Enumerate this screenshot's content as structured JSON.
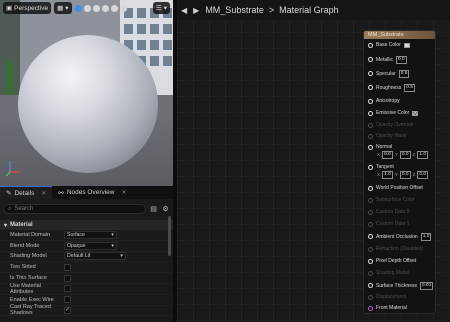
{
  "viewport": {
    "mode_label": "Perspective",
    "toolbar_icons": [
      "camera-icon",
      "view-mode-icon",
      "globe-icon",
      "sphere-preview-icon",
      "cylinder-preview-icon",
      "plane-preview-icon",
      "cube-preview-icon",
      "teapot-icon",
      "menu-icon"
    ]
  },
  "details": {
    "tabs": [
      {
        "label": "Details",
        "icon": "pencil-icon"
      },
      {
        "label": "Nodes Overview",
        "icon": "hierarchy-icon"
      }
    ],
    "search_placeholder": "Search",
    "section_title": "Material",
    "properties": [
      {
        "name": "Material Domain",
        "type": "combo",
        "value": "Surface"
      },
      {
        "name": "Blend Mode",
        "type": "combo",
        "value": "Opaque"
      },
      {
        "name": "Shading Model",
        "type": "combo",
        "value": "Default Lit"
      },
      {
        "name": "Two Sided",
        "type": "check",
        "checked": false
      },
      {
        "name": "Is Thin Surface",
        "type": "check",
        "checked": false
      },
      {
        "name": "Use Material Attributes",
        "type": "check",
        "checked": false
      },
      {
        "name": "Enable Exec Wire",
        "type": "check",
        "checked": false
      },
      {
        "name": "Cast Ray Traced Shadows",
        "type": "check",
        "checked": true
      }
    ]
  },
  "graph": {
    "breadcrumb": [
      "MM_Substrate",
      "Material Graph"
    ],
    "separator": ">"
  },
  "node": {
    "title": "MM_Substrate",
    "pins": {
      "base_color": "Base Color",
      "metallic": "Metallic",
      "metallic_value": "0.0",
      "specular": "Specular",
      "specular_value": "0.5",
      "roughness": "Roughness",
      "roughness_value": "0.5",
      "anisotropy": "Anisotropy",
      "emissive": "Emissive Color",
      "opacity": "Opacity Override",
      "opacity_mask": "Opacity Mask",
      "normal": "Normal",
      "normal_x": "0.0",
      "normal_y": "0.0",
      "normal_z": "1.0",
      "tangent": "Tangent",
      "tangent_x": "1.0",
      "tangent_y": "0.0",
      "tangent_z": "0.0",
      "wpo": "World Position Offset",
      "subsurface": "Subsurface Color",
      "custom0": "Custom Data 0",
      "custom1": "Custom Data 1",
      "ao": "Ambient Occlusion",
      "ao_value": "1.0",
      "refraction": "Refraction (Disabled)",
      "pdo": "Pixel Depth Offset",
      "shading_model": "Shading Model",
      "surface_thickness": "Surface Thickness",
      "surface_thickness_value": "0.01",
      "displacement": "Displacement",
      "front_material": "Front Material"
    },
    "axis_labels": {
      "x": "X",
      "y": "Y",
      "z": "Z"
    }
  },
  "colors": {
    "accent_blue": "#3d8ee8",
    "node_header": "#9b7e5a",
    "front_material_pin": "#c25bd6"
  }
}
